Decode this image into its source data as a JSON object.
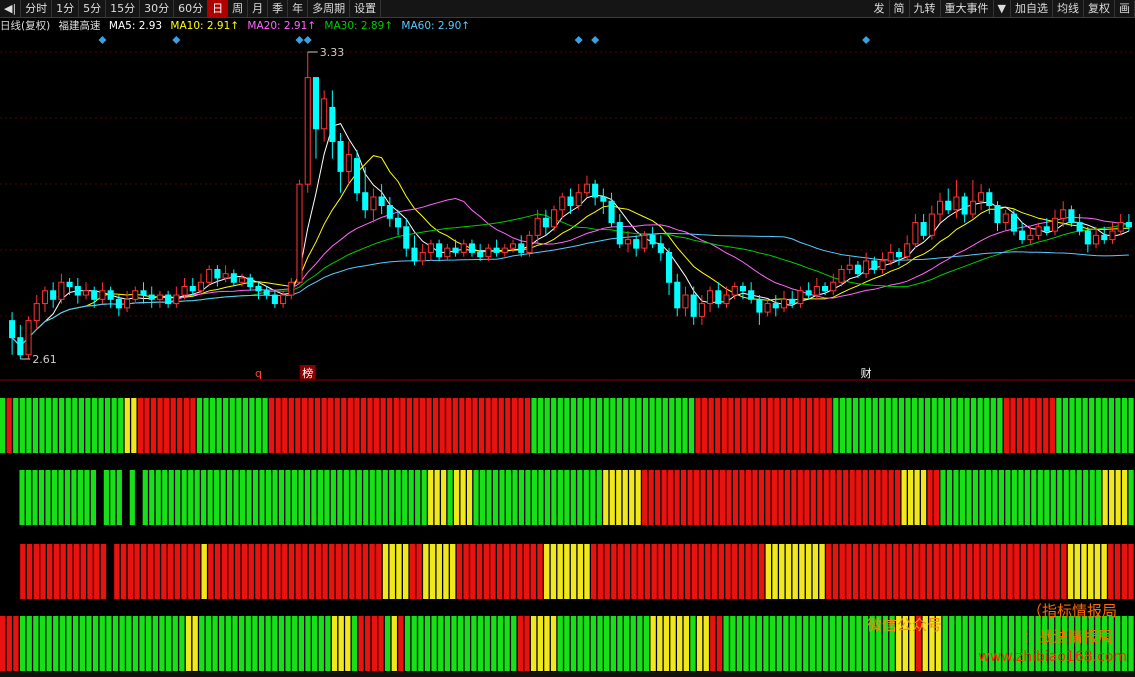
{
  "toolbar": {
    "left_items": [
      {
        "label": "◀|",
        "active": false
      },
      {
        "label": "分时",
        "active": false
      },
      {
        "label": "1分",
        "active": false
      },
      {
        "label": "5分",
        "active": false
      },
      {
        "label": "15分",
        "active": false
      },
      {
        "label": "30分",
        "active": false
      },
      {
        "label": "60分",
        "active": false
      },
      {
        "label": "日",
        "active": true
      },
      {
        "label": "周",
        "active": false
      },
      {
        "label": "月",
        "active": false
      },
      {
        "label": "季",
        "active": false
      },
      {
        "label": "年",
        "active": false
      },
      {
        "label": "多周期",
        "active": false
      },
      {
        "label": "设置",
        "active": false
      }
    ],
    "right_items": [
      "发",
      "简",
      "九转",
      "重大事件",
      "▼",
      "加自选",
      "均线",
      "复权",
      "画"
    ]
  },
  "info": {
    "period": "日线(复权)",
    "stock_name": "福建高速",
    "ma": [
      {
        "label": "MA5: 2.93",
        "color": "#ffffff"
      },
      {
        "label": "MA10: 2.91↑",
        "color": "#ffff00"
      },
      {
        "label": "MA20: 2.91↑",
        "color": "#ff66ff"
      },
      {
        "label": "MA30: 2.89↑",
        "color": "#00cc00"
      },
      {
        "label": "MA60: 2.90↑",
        "color": "#55ccff"
      }
    ]
  },
  "chart_data": {
    "type": "candlestick",
    "high_label": "3.33",
    "low_label": "2.61",
    "candles": [
      [
        2.7,
        2.66,
        2.72,
        2.62
      ],
      [
        2.66,
        2.62,
        2.69,
        2.61
      ],
      [
        2.62,
        2.7,
        2.71,
        2.61
      ],
      [
        2.7,
        2.74,
        2.76,
        2.68
      ],
      [
        2.74,
        2.77,
        2.78,
        2.72
      ],
      [
        2.77,
        2.75,
        2.79,
        2.73
      ],
      [
        2.75,
        2.79,
        2.81,
        2.74
      ],
      [
        2.79,
        2.78,
        2.8,
        2.76
      ],
      [
        2.78,
        2.76,
        2.8,
        2.74
      ],
      [
        2.76,
        2.77,
        2.79,
        2.75
      ],
      [
        2.77,
        2.75,
        2.78,
        2.73
      ],
      [
        2.75,
        2.77,
        2.79,
        2.74
      ],
      [
        2.77,
        2.75,
        2.78,
        2.73
      ],
      [
        2.75,
        2.73,
        2.76,
        2.71
      ],
      [
        2.73,
        2.75,
        2.77,
        2.72
      ],
      [
        2.75,
        2.77,
        2.78,
        2.74
      ],
      [
        2.77,
        2.76,
        2.79,
        2.74
      ],
      [
        2.76,
        2.75,
        2.78,
        2.73
      ],
      [
        2.75,
        2.76,
        2.77,
        2.73
      ],
      [
        2.76,
        2.74,
        2.77,
        2.73
      ],
      [
        2.74,
        2.76,
        2.78,
        2.73
      ],
      [
        2.76,
        2.78,
        2.8,
        2.75
      ],
      [
        2.78,
        2.77,
        2.8,
        2.76
      ],
      [
        2.77,
        2.79,
        2.81,
        2.76
      ],
      [
        2.79,
        2.82,
        2.83,
        2.78
      ],
      [
        2.82,
        2.8,
        2.83,
        2.78
      ],
      [
        2.8,
        2.81,
        2.83,
        2.79
      ],
      [
        2.81,
        2.79,
        2.82,
        2.78
      ],
      [
        2.79,
        2.8,
        2.81,
        2.78
      ],
      [
        2.8,
        2.78,
        2.81,
        2.77
      ],
      [
        2.78,
        2.77,
        2.79,
        2.75
      ],
      [
        2.77,
        2.76,
        2.78,
        2.75
      ],
      [
        2.76,
        2.74,
        2.77,
        2.73
      ],
      [
        2.74,
        2.76,
        2.77,
        2.73
      ],
      [
        2.76,
        2.79,
        2.8,
        2.75
      ],
      [
        2.79,
        3.02,
        3.03,
        2.79
      ],
      [
        3.02,
        3.27,
        3.33,
        3.0
      ],
      [
        3.27,
        3.15,
        3.25,
        3.08
      ],
      [
        3.15,
        3.22,
        3.24,
        3.12
      ],
      [
        3.2,
        3.12,
        3.24,
        3.08
      ],
      [
        3.12,
        3.05,
        3.14,
        3.0
      ],
      [
        3.05,
        3.09,
        3.12,
        3.02
      ],
      [
        3.08,
        3.0,
        3.1,
        2.98
      ],
      [
        3.0,
        2.96,
        3.06,
        2.94
      ],
      [
        2.96,
        2.99,
        3.01,
        2.93
      ],
      [
        2.99,
        2.97,
        3.02,
        2.95
      ],
      [
        2.97,
        2.94,
        2.99,
        2.92
      ],
      [
        2.94,
        2.92,
        2.96,
        2.9
      ],
      [
        2.92,
        2.87,
        2.94,
        2.85
      ],
      [
        2.87,
        2.84,
        2.9,
        2.83
      ],
      [
        2.84,
        2.86,
        2.88,
        2.83
      ],
      [
        2.86,
        2.88,
        2.89,
        2.84
      ],
      [
        2.88,
        2.85,
        2.89,
        2.84
      ],
      [
        2.85,
        2.87,
        2.88,
        2.84
      ],
      [
        2.87,
        2.86,
        2.89,
        2.85
      ],
      [
        2.86,
        2.88,
        2.89,
        2.85
      ],
      [
        2.88,
        2.86,
        2.89,
        2.85
      ],
      [
        2.86,
        2.85,
        2.88,
        2.84
      ],
      [
        2.85,
        2.87,
        2.88,
        2.84
      ],
      [
        2.87,
        2.86,
        2.89,
        2.85
      ],
      [
        2.86,
        2.87,
        2.88,
        2.85
      ],
      [
        2.87,
        2.88,
        2.89,
        2.86
      ],
      [
        2.88,
        2.86,
        2.9,
        2.85
      ],
      [
        2.86,
        2.9,
        2.91,
        2.85
      ],
      [
        2.9,
        2.94,
        2.96,
        2.88
      ],
      [
        2.94,
        2.92,
        2.96,
        2.9
      ],
      [
        2.92,
        2.96,
        2.97,
        2.91
      ],
      [
        2.96,
        2.99,
        3.0,
        2.94
      ],
      [
        2.99,
        2.97,
        3.01,
        2.95
      ],
      [
        2.97,
        3.0,
        3.02,
        2.96
      ],
      [
        3.0,
        3.02,
        3.04,
        2.99
      ],
      [
        3.02,
        2.99,
        3.03,
        2.97
      ],
      [
        2.99,
        2.98,
        3.01,
        2.95
      ],
      [
        2.98,
        2.93,
        3.0,
        2.92
      ],
      [
        2.93,
        2.88,
        2.95,
        2.87
      ],
      [
        2.88,
        2.89,
        2.91,
        2.86
      ],
      [
        2.89,
        2.87,
        2.9,
        2.85
      ],
      [
        2.87,
        2.9,
        2.91,
        2.86
      ],
      [
        2.9,
        2.88,
        2.92,
        2.87
      ],
      [
        2.88,
        2.86,
        2.9,
        2.84
      ],
      [
        2.86,
        2.79,
        2.87,
        2.76
      ],
      [
        2.79,
        2.73,
        2.81,
        2.71
      ],
      [
        2.73,
        2.76,
        2.78,
        2.71
      ],
      [
        2.76,
        2.71,
        2.78,
        2.69
      ],
      [
        2.71,
        2.74,
        2.76,
        2.69
      ],
      [
        2.74,
        2.77,
        2.78,
        2.72
      ],
      [
        2.77,
        2.74,
        2.79,
        2.73
      ],
      [
        2.74,
        2.76,
        2.78,
        2.73
      ],
      [
        2.76,
        2.78,
        2.79,
        2.75
      ],
      [
        2.78,
        2.77,
        2.79,
        2.75
      ],
      [
        2.77,
        2.75,
        2.79,
        2.74
      ],
      [
        2.75,
        2.72,
        2.76,
        2.69
      ],
      [
        2.72,
        2.74,
        2.75,
        2.71
      ],
      [
        2.74,
        2.73,
        2.76,
        2.71
      ],
      [
        2.73,
        2.75,
        2.77,
        2.72
      ],
      [
        2.75,
        2.74,
        2.77,
        2.73
      ],
      [
        2.74,
        2.77,
        2.78,
        2.73
      ],
      [
        2.77,
        2.76,
        2.79,
        2.75
      ],
      [
        2.76,
        2.78,
        2.8,
        2.75
      ],
      [
        2.78,
        2.77,
        2.79,
        2.76
      ],
      [
        2.77,
        2.79,
        2.81,
        2.76
      ],
      [
        2.79,
        2.82,
        2.83,
        2.78
      ],
      [
        2.82,
        2.83,
        2.85,
        2.81
      ],
      [
        2.83,
        2.81,
        2.84,
        2.8
      ],
      [
        2.81,
        2.84,
        2.86,
        2.8
      ],
      [
        2.84,
        2.82,
        2.85,
        2.81
      ],
      [
        2.82,
        2.84,
        2.86,
        2.81
      ],
      [
        2.84,
        2.86,
        2.88,
        2.83
      ],
      [
        2.86,
        2.85,
        2.87,
        2.83
      ],
      [
        2.85,
        2.88,
        2.9,
        2.84
      ],
      [
        2.88,
        2.93,
        2.95,
        2.87
      ],
      [
        2.93,
        2.9,
        2.95,
        2.89
      ],
      [
        2.9,
        2.95,
        2.97,
        2.89
      ],
      [
        2.95,
        2.98,
        3.0,
        2.93
      ],
      [
        2.98,
        2.96,
        3.01,
        2.95
      ],
      [
        2.96,
        2.99,
        3.03,
        2.94
      ],
      [
        2.99,
        2.95,
        3.0,
        2.93
      ],
      [
        2.95,
        2.98,
        3.03,
        2.94
      ],
      [
        2.98,
        3.0,
        3.02,
        2.96
      ],
      [
        3.0,
        2.97,
        3.01,
        2.95
      ],
      [
        2.97,
        2.93,
        2.98,
        2.91
      ],
      [
        2.93,
        2.95,
        2.96,
        2.91
      ],
      [
        2.95,
        2.91,
        2.96,
        2.9
      ],
      [
        2.91,
        2.89,
        2.93,
        2.88
      ],
      [
        2.89,
        2.9,
        2.92,
        2.88
      ],
      [
        2.9,
        2.92,
        2.93,
        2.89
      ],
      [
        2.92,
        2.91,
        2.94,
        2.9
      ],
      [
        2.91,
        2.94,
        2.96,
        2.9
      ],
      [
        2.94,
        2.96,
        2.98,
        2.92
      ],
      [
        2.96,
        2.93,
        2.97,
        2.92
      ],
      [
        2.93,
        2.91,
        2.95,
        2.9
      ],
      [
        2.91,
        2.88,
        2.92,
        2.86
      ],
      [
        2.88,
        2.9,
        2.92,
        2.87
      ],
      [
        2.9,
        2.89,
        2.92,
        2.88
      ],
      [
        2.89,
        2.91,
        2.93,
        2.88
      ],
      [
        2.91,
        2.93,
        2.95,
        2.9
      ],
      [
        2.93,
        2.92,
        2.95,
        2.91
      ]
    ],
    "annotations": [
      {
        "text": "q",
        "index": 30,
        "color": "#ff4040",
        "boxed": false
      },
      {
        "text": "榜",
        "index": 36,
        "color": "#ffffff",
        "boxed": true
      },
      {
        "text": "财",
        "index": 104,
        "color": "#ffffff",
        "boxed": false
      }
    ],
    "event_markers": [
      11,
      20,
      35,
      36,
      69,
      71,
      104
    ],
    "indicator_rows": [
      "GRGGGGGGGGGGGGGGGGGYYRRRRRRRRRGGGGGGGGGGGRRRRRRRRRRRRRRRRRRRRRRRRRRRRRRRRRRRRRRRRGGGGGGGGGGGGGGGGGGGGGGGGGRRRRRRRRRRRRRRRRRRRRRGGGGGGGGGGGGGGGGGGGGGGGGGGRRRRRRRRGGGGGGGGGGGG",
      "...GGGGGGGGGGGG.GGG.G.GGGGGGGGGGGGGGGGGGGGGGGGGGGGGGGGGGGGGGGGGGGGYYYGYYYGGGGGGGGGGGGGGGGGGGGYYYYYYRRRRRRRRRRRRRRRRRRRRRRRRRRRRRRRRRRRRRRRRYYYYRRGGGGGGGGGGGGGGGGGGGGGGGGGYYYYG",
      "...RRRRRRRRRRRRR.RRRRRRRRRRRRRYRRRRRRRRRRRRRRRRRRRRRRRRRRYYYYRRYYYYYRRRRRRRRRRRRRYYYYYYYRRRRRRRRRRRRRRRRRRRRRRRRRRYYYYYYYYYRRRRRRRRRRRRRRRRRRRRRRRRRRRRRRRRRRRRYYYYYYRRRR",
      "RRRGGGGGGGGGGGGGGGGGGGGGGGGGYYGGGGGGGGGGGGGGGGGGGGYYYGRRRRGYRGGGGGGGGGGGGGGGGGRRYYYYGGGGGGGGGGGGGGYYYYYYGYYRRGGGGGGGGGGGGGGGGGGGGGGGGGGYYYRYYYGGGGGGGGGGGGGGGGGGGGGGGGGGGGG"
    ],
    "indicator_colors": {
      "R": "#e8120f",
      "G": "#18e018",
      "Y": "#f0e81a"
    },
    "candle_colors": {
      "up": "#ff3333",
      "down": "#00ffff"
    },
    "ma_colors": [
      "#ffffff",
      "#ffff00",
      "#ff66ff",
      "#00cc00",
      "#55ccff"
    ]
  },
  "watermark": {
    "line1": "（指标情报局",
    "line2": "微信公众号",
    "line3": "：战法情报局",
    "line4": "www.zhibiao168.com"
  }
}
